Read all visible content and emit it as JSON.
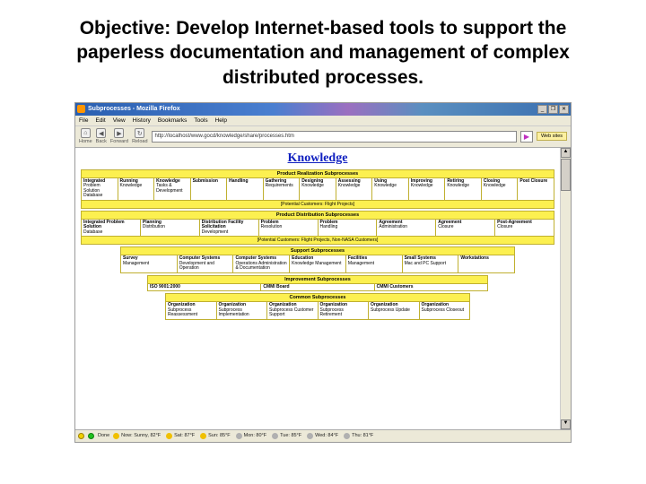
{
  "slide": {
    "title": "Objective:\nDevelop Internet-based tools to support the paperless documentation and management of complex distributed processes."
  },
  "browser": {
    "window_title": "Subprocesses - Mozilla Firefox",
    "menu": [
      "File",
      "Edit",
      "View",
      "History",
      "Bookmarks",
      "Tools",
      "Help"
    ],
    "toolbar": {
      "home": "Home",
      "back": "Back",
      "forward": "Forward",
      "reload": "Reload"
    },
    "url": "http://localhost/www.gocd/knowledge/share/processes.htm",
    "go_label": "Go",
    "tab_label": "Web sites"
  },
  "page": {
    "main_title": "Knowledge",
    "sections": [
      {
        "header": "Product Realization Subprocesses",
        "footer": "[Potential Customers: Flight Projects]",
        "items": [
          {
            "t": "Integrated",
            "s": "Problem Solution Database"
          },
          {
            "t": "Running",
            "s": "Knowledge"
          },
          {
            "t": "Knowledge",
            "s": "Tasks & Development"
          },
          {
            "t": "Submission",
            "s": ""
          },
          {
            "t": "Handling",
            "s": ""
          },
          {
            "t": "Gathering",
            "s": "Requirements"
          },
          {
            "t": "Designing",
            "s": "Knowledge"
          },
          {
            "t": "Assessing",
            "s": "Knowledge"
          },
          {
            "t": "Using",
            "s": "Knowledge"
          },
          {
            "t": "Improving",
            "s": "Knowledge"
          },
          {
            "t": "Retiring",
            "s": "Knowledge"
          },
          {
            "t": "Closing",
            "s": "Knowledge"
          },
          {
            "t": "Post Closure",
            "s": ""
          }
        ]
      },
      {
        "header": "Product Distribution Subprocesses",
        "footer": "[Potential Customers: Flight Projects, Non-NASA Customers]",
        "items": [
          {
            "t": "Integrated Problem Solution",
            "s": "Database"
          },
          {
            "t": "Planning",
            "s": "Distribution"
          },
          {
            "t": "Distribution Facility Solicitation",
            "s": "Development"
          },
          {
            "t": "Problem",
            "s": "Resolution"
          },
          {
            "t": "Problem",
            "s": "Handling"
          },
          {
            "t": "Agreement",
            "s": "Administration"
          },
          {
            "t": "Agreement",
            "s": "Closure"
          },
          {
            "t": "Post-Agreement",
            "s": "Closure"
          }
        ]
      },
      {
        "header": "Support Subprocesses",
        "footer": "",
        "items": [
          {
            "t": "Survey",
            "s": "Management"
          },
          {
            "t": "Computer Systems",
            "s": "Development and Operation"
          },
          {
            "t": "Computer Systems",
            "s": "Operations Administration & Documentation"
          },
          {
            "t": "Education",
            "s": "Knowledge Management"
          },
          {
            "t": "Facilities",
            "s": "Management"
          },
          {
            "t": "Small Systems",
            "s": "Mac and PC Support"
          },
          {
            "t": "Workstations",
            "s": ""
          }
        ]
      },
      {
        "header": "Improvement Subprocesses",
        "footer": "",
        "items": [
          {
            "t": "ISO 9001:2000",
            "s": ""
          },
          {
            "t": "CMMI Board",
            "s": ""
          },
          {
            "t": "CMMI Customers",
            "s": ""
          }
        ]
      },
      {
        "header": "Common Subprocesses",
        "footer": "",
        "items": [
          {
            "t": "Organization",
            "s": "Subprocess Reassessment"
          },
          {
            "t": "Organization",
            "s": "Subprocess Implementation"
          },
          {
            "t": "Organization",
            "s": "Subprocess Customer Support"
          },
          {
            "t": "Organization",
            "s": "Subprocess Retirement"
          },
          {
            "t": "Organization",
            "s": "Subprocess Update"
          },
          {
            "t": "Organization",
            "s": "Subprocess Closeout"
          }
        ]
      }
    ]
  },
  "status": {
    "done": "Done",
    "items": [
      "Now: Sunny, 82°F",
      "Sat: 87°F",
      "Sun: 85°F",
      "Mon: 80°F",
      "Tue: 85°F",
      "Wed: 84°F",
      "Thu: 81°F"
    ]
  }
}
